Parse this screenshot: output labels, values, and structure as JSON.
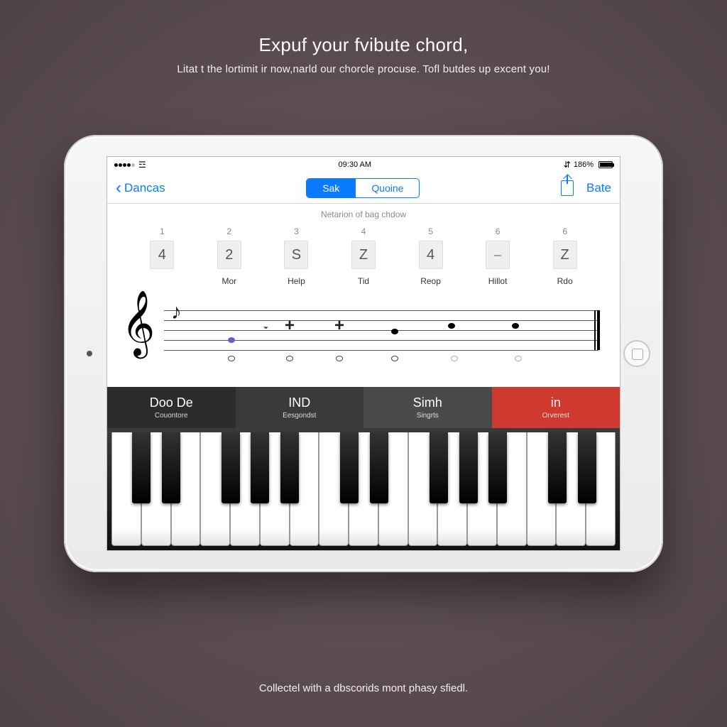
{
  "promo": {
    "title": "Expuf your fvibute chord,",
    "subtitle": "Litat t the lortimit ir now,narld our chorcle procuse. Tofl butdes up excent you!",
    "footer": "Collectel with a dbscorids mont phasy sfiedl."
  },
  "statusbar": {
    "time": "09:30 AM",
    "battery_pct": "186%"
  },
  "navbar": {
    "back_label": "Dancas",
    "segments": [
      "Sak",
      "Quoine"
    ],
    "active_segment": 0,
    "right_button": "Bate"
  },
  "section_title": "Netarion of bag chdow",
  "slots": [
    {
      "num": "1",
      "glyph": "4",
      "label": ""
    },
    {
      "num": "2",
      "glyph": "2",
      "label": "Mor"
    },
    {
      "num": "3",
      "glyph": "S",
      "label": "Help"
    },
    {
      "num": "4",
      "glyph": "Z",
      "label": "Tid"
    },
    {
      "num": "5",
      "glyph": "4",
      "label": "Reop"
    },
    {
      "num": "6",
      "glyph": "⎯",
      "label": "Hillot"
    },
    {
      "num": "6",
      "glyph": "Z",
      "label": "Rdo"
    }
  ],
  "actionbar": [
    {
      "big": "Doo De",
      "small": "Couontore"
    },
    {
      "big": "IND",
      "small": "Eesgondst"
    },
    {
      "big": "Simh",
      "small": "Singrts"
    },
    {
      "big": "in",
      "small": "Orverest"
    }
  ],
  "keyboard": {
    "white_keys": 17
  }
}
